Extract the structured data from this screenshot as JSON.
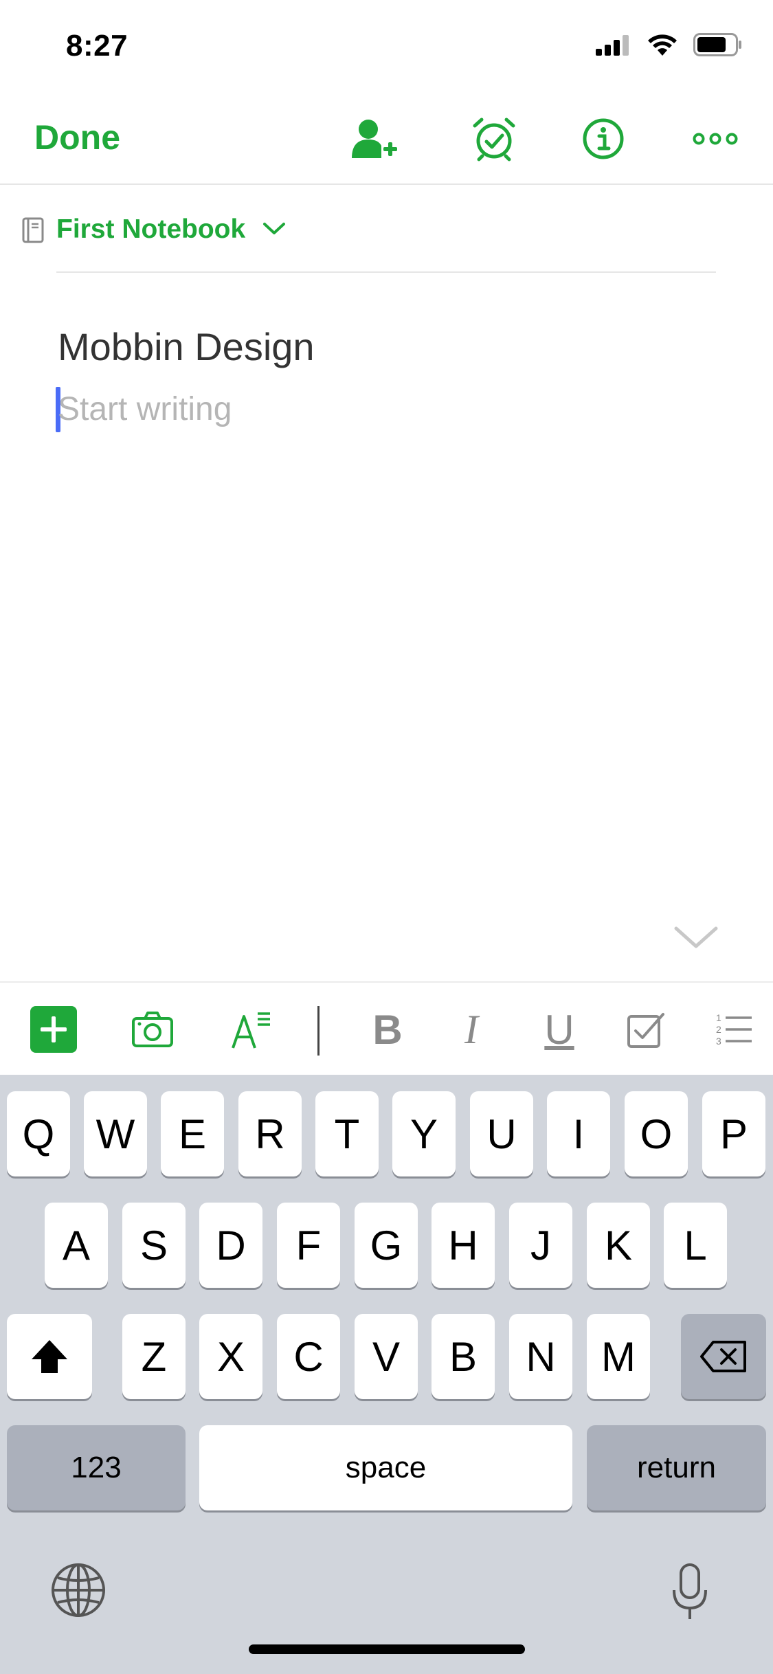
{
  "status_bar": {
    "time": "8:27"
  },
  "nav": {
    "done_label": "Done"
  },
  "notebook": {
    "name": "First Notebook"
  },
  "note": {
    "title": "Mobbin Design",
    "body_placeholder": "Start writing"
  },
  "format_toolbar": {
    "items": [
      "add-icon",
      "camera-icon",
      "text-format-icon",
      "bold-icon",
      "italic-icon",
      "underline-icon",
      "checkbox-icon",
      "numbered-list-icon"
    ],
    "bold_glyph": "B",
    "italic_glyph": "I",
    "underline_glyph": "U"
  },
  "keyboard": {
    "row1": [
      "Q",
      "W",
      "E",
      "R",
      "T",
      "Y",
      "U",
      "I",
      "O",
      "P"
    ],
    "row2": [
      "A",
      "S",
      "D",
      "F",
      "G",
      "H",
      "J",
      "K",
      "L"
    ],
    "row3": [
      "Z",
      "X",
      "C",
      "V",
      "B",
      "N",
      "M"
    ],
    "numbers_label": "123",
    "space_label": "space",
    "return_label": "return"
  },
  "colors": {
    "accent": "#1fa83a",
    "caret": "#4a6cf7",
    "keyboard_bg": "#d1d5dc"
  }
}
